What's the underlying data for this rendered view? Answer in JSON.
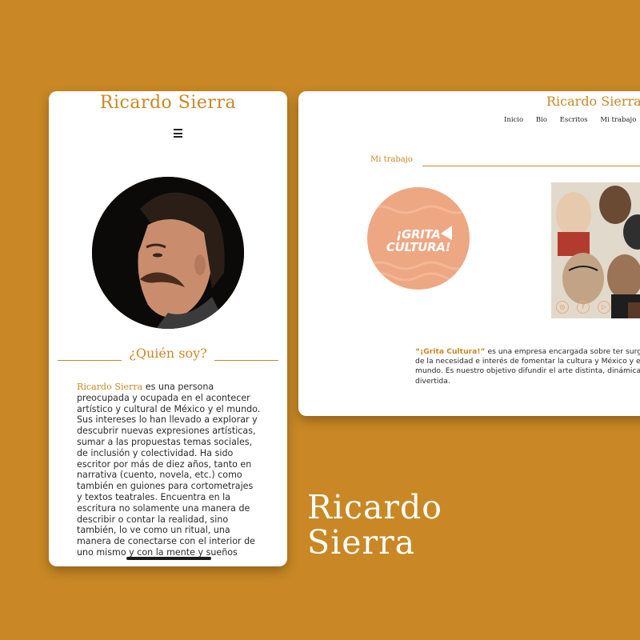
{
  "brand_name": "Ricardo Sierra",
  "mobile": {
    "title": "Ricardo Sierra",
    "menu_icon": "hamburger-icon",
    "section_heading": "¿Quién soy?",
    "bio_name": "Ricardo Sierra",
    "bio_rest": " es una persona preocupada y ocupada en el acontecer artístico y cultural de México y el mundo. Sus intereses lo han llevado a explorar y descubrir nuevas expresiones artísticas, sumar a las propuestas temas sociales, de inclusión y colectividad. Ha sido escritor por más de diez años, tanto en narrativa (cuento, novela, etc.) como también en guiones para cortometrajes y textos teatrales. Encuentra en la escritura no solamente una manera de describir o contar la realidad, sino también, lo ve como un ritual, una manera de conectarse con el interior de uno mismo y con la mente y sueños"
  },
  "desktop": {
    "title": "Ricardo Sierra",
    "nav": [
      "Inicio",
      "Bio",
      "Escritos",
      "Mi trabajo"
    ],
    "section_label": "Mi trabajo",
    "logo_text_1": "¡GRITA",
    "logo_text_2": "CULTURA!",
    "social_icons": [
      "instagram-icon",
      "facebook-icon",
      "youtube-icon"
    ],
    "desc_brand": "“¡Grita Cultura!”",
    "desc_rest": " es una empresa encargada sobre ter surge de la necesidad e interés de fomentar la cultura y México y el mundo. Es nuestro objetivo difundir el arte distinta, dinámica y divertida."
  },
  "big_label": [
    "Ricardo",
    "Sierra"
  ],
  "colors": {
    "background": "#c98825",
    "accent": "#c98825",
    "logo_peach": "#eea783"
  }
}
